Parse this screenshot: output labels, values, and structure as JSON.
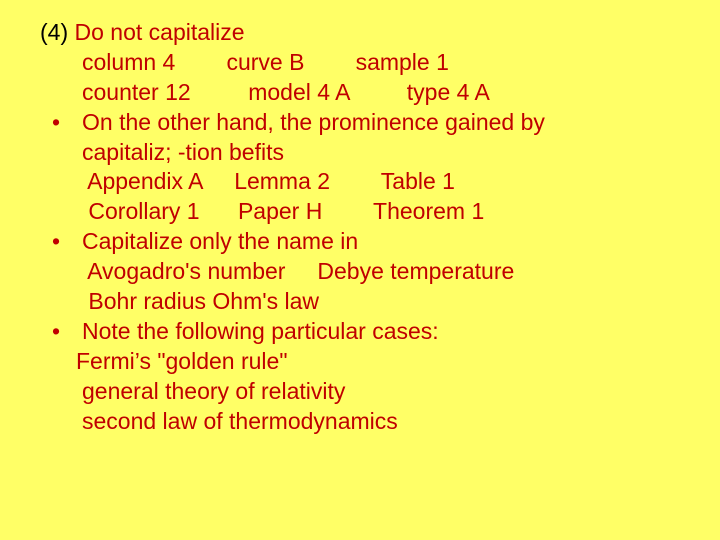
{
  "heading": {
    "marker": "(4) ",
    "text": "Do not capitalize"
  },
  "examples1": {
    "row1": {
      "a": "column 4",
      "b": "curve B",
      "c": "sample 1"
    },
    "row2": {
      "a": "counter 12",
      "b": "model 4 A",
      "c": "type 4 A"
    }
  },
  "bullet1": {
    "dot": "•",
    "line1": "On the other hand, the prominence gained by",
    "line2": "capitaliz; -tion befits",
    "ex_row1": {
      "a": "Appendix A",
      "b": "Lemma 2",
      "c": "Table 1"
    },
    "ex_row2": {
      "a": "Corollary 1",
      "b": "Paper H",
      "c": "Theorem 1"
    }
  },
  "bullet2": {
    "dot": "•",
    "line1": "Capitalize only the name in",
    "ex_row1": {
      "a": "Avogadro's number",
      "b": "Debye temperature"
    },
    "ex_row2": {
      "a": "Bohr radius Ohm's law"
    }
  },
  "bullet3": {
    "dot": "•",
    "line1": "Note the following particular cases:",
    "ex1": "Fermi’s \"golden rule\"",
    "ex2": "general theory of relativity",
    "ex3": "second law of thermodynamics"
  }
}
